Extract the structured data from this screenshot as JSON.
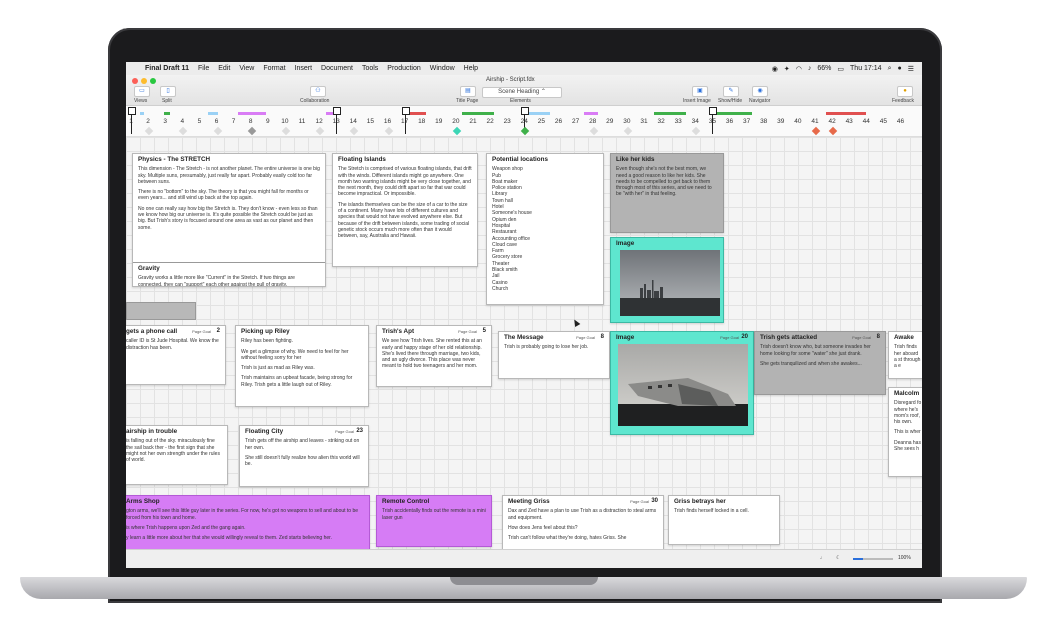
{
  "menubar": {
    "app": "Final Draft 11",
    "items": [
      "File",
      "Edit",
      "View",
      "Format",
      "Insert",
      "Document",
      "Tools",
      "Production",
      "Window",
      "Help"
    ],
    "battery": "66%",
    "clock": "Thu 17:14"
  },
  "window": {
    "title": "Airship - Script.fdx",
    "toolbar": {
      "views": "Views",
      "split": "Split",
      "collaboration": "Collaboration",
      "title_page": "Title Page",
      "elements_label": "Elements",
      "elements_value": "Scene Heading",
      "insert_image": "Insert Image",
      "show_hide": "Show/Hide",
      "navigator": "Navigator",
      "feedback": "Feedback"
    }
  },
  "ruler": {
    "numbers": [
      "1",
      "2",
      "3",
      "4",
      "5",
      "6",
      "7",
      "8",
      "9",
      "10",
      "11",
      "12",
      "13",
      "14",
      "15",
      "16",
      "17",
      "18",
      "19",
      "20",
      "21",
      "22",
      "23",
      "24",
      "25",
      "26",
      "27",
      "28",
      "29",
      "30",
      "31",
      "32",
      "33",
      "34",
      "35",
      "36",
      "37",
      "38",
      "39",
      "40",
      "41",
      "42",
      "43",
      "44",
      "45",
      "46"
    ]
  },
  "cards": {
    "physics": {
      "title": "Physics - The STRETCH",
      "p1": "This dimension - The Stretch - is not another planet. The entire universe is one big sky. Multiple suns, presumably, just really far apart. Probably easily cold too far between suns.",
      "p2": "There is no \"bottom\" to the sky. The theory is that you might fall for months or even years... and still wind up back at the top again.",
      "p3": "No one can really say how big the Stretch is. They don't know - even less so than we know how big our universe is. It's quite possible the Stretch could be just as big. But Trish's story is focused around one area as vast as our planet and then some."
    },
    "gravity": {
      "title": "Gravity",
      "body": "Gravity works a little more like \"Current\" in the Stretch. If two things are connected, they can \"support\" each other against the pull of gravity."
    },
    "floating": {
      "title": "Floating Islands",
      "p1": "The Stretch is comprised of various floating islands, that drift with the winds. Different islands might go anywhere. One month two warring islands might be very close together, and the next month, they could drift apart so far that war could become impractical. Or impossible.",
      "p2": "The islands themselves can be the size of a car to the size of a continent. Many have lots of different cultures and species that would not have evolved anywhere else. But because of the drift between islands, some trading of social genetic stock occurs much more often than it would between, say, Australia and Hawaii."
    },
    "locations": {
      "title": "Potential locations",
      "items": [
        "Weapon shop",
        "Pub",
        "Boat maker",
        "Police station",
        "Library",
        "Town hall",
        "Hotel",
        "Someone's house",
        "Opium den",
        "Hospital",
        "Restaurant",
        "Accounting office",
        "Cloud cave",
        "Farm",
        "Grocery store",
        "Theater",
        "Black smith",
        "Jail",
        "Casino",
        "Church"
      ]
    },
    "like_her_kids": {
      "title": "Like her kids",
      "body": "Even though she's not the best mom, we need a good reason to like her kids. She needs to be compelled to get back to them through most of this series, and we need to be \"with her\" in that feeling."
    },
    "image_top": {
      "title": "Image"
    },
    "phone_call": {
      "title": "gets a phone call",
      "goal": "Page Goal",
      "num": "2",
      "body": "caller ID is St Jude Hospital. We know the distraction has been."
    },
    "picking_up": {
      "title": "Picking up Riley",
      "p1": "Riley has been fighting.",
      "p2": "We get a glimpse of why. We need to feel for her without feeling sorry for her",
      "p3": "Trish is just as mad as Riley was.",
      "p4": "Trish maintains an upbeat facade, being strong for Riley. Trish gets a little laugh out of Riley."
    },
    "trishs_apt": {
      "title": "Trish's Apt",
      "goal": "Page Goal",
      "num": "5",
      "body": "We see how Trish lives. She rented this at an early and happy stage of her old relationship. She's lived there through marriage, two kids, and an ugly divorce. This place was never meant to hold two teenagers and her mom."
    },
    "message": {
      "title": "The Message",
      "goal": "Page Goal",
      "num": "8",
      "body": "Trish is probably going to lose her job."
    },
    "image_plane": {
      "title": "Image",
      "goal": "Page Goal",
      "num": "20"
    },
    "attacked": {
      "title": "Trish gets attacked",
      "goal": "Page Goal",
      "num": "8",
      "p1": "Trish doesn't know who, but someone invades her home looking for some \"water\" she just drank.",
      "p2": "She gets tranquilized and when she awakes..."
    },
    "awake": {
      "title": "Awake",
      "body": "Trish finds her aboard a st through a e"
    },
    "malcolm": {
      "title": "Malcolm",
      "p1": "Disregard fo where he's mom's roof, his own.",
      "p2": "This is wher",
      "p3": "Deanna has She sees h"
    },
    "airship_trouble": {
      "title": "airship in trouble",
      "body": "is falling out of the sky. miraculously fine the sail back ther - the first sign that she might not her own strength under the rules of world."
    },
    "floating_city": {
      "title": "Floating City",
      "goal": "Page Goal",
      "num": "23",
      "p1": "Trish gets off the airship and leaves - striking out on her own.",
      "p2": "She still doesn't fully realize how alien this world will be."
    },
    "arms_shop": {
      "title": "Arms Shop",
      "p1": "gton arms, we'll see this little guy later in the series. For now, he's got no weapons to sell and about to be forced from his town and home.",
      "p2": "is where Trish happens upon Zed and the gang again.",
      "p3": "y learn a little more about her that she would willingly reveal to them. Zed starts believing her."
    },
    "remote": {
      "title": "Remote Control",
      "body": "Trish accidentally finds out the remote is a mini laser gun"
    },
    "meeting_griss": {
      "title": "Meeting Griss",
      "goal": "Page Goal",
      "num": "30",
      "p1": "Dax and Zed have a plan to use Trish as a distraction to steal arms and equipment.",
      "p2": "How does Jens feel about this?",
      "p3": "Trish can't follow what they're doing, hates Griss. She"
    },
    "griss_betrays": {
      "title": "Griss betrays her",
      "body": "Trish finds herself locked in a cell."
    }
  },
  "status": {
    "zoom": "100%"
  },
  "colors": {
    "cyan": "#5ee6cf",
    "purple": "#d67cf5",
    "gray": "#b3b3b3",
    "accent": "#2a6fdb"
  }
}
